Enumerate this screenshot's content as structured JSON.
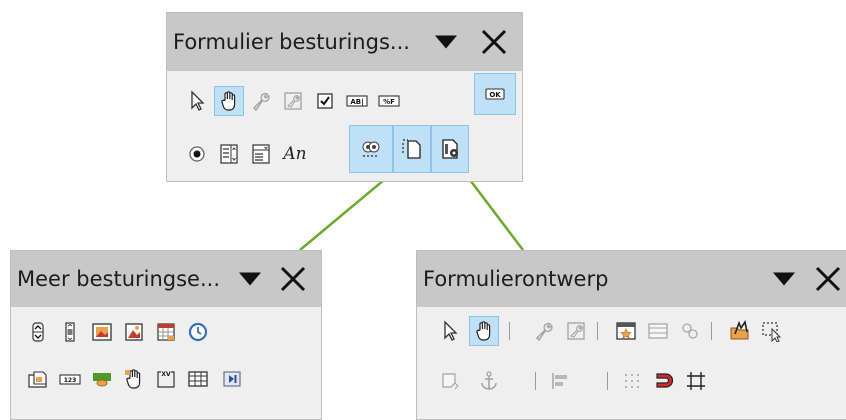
{
  "toolbars": {
    "form_controls": {
      "title": "Formulier besturings...",
      "icons": {
        "row1": [
          "select-arrow-icon",
          "design-mode-hand-icon",
          "control-properties-wrench-icon",
          "form-properties-icon",
          "checkbox-icon",
          "text-box-icon",
          "formatted-field-icon",
          "push-button-icon"
        ],
        "row2": [
          "option-button-icon",
          "list-box-icon",
          "combo-box-icon",
          "label-field-icon",
          "more-controls-icon",
          "form-design-icon",
          "wizards-icon"
        ]
      },
      "label_field_text": "An",
      "push_button_text": "OK",
      "text_box_text": "AB|",
      "formatted_field_text": "%F"
    },
    "more_controls": {
      "title": "Meer besturingse...",
      "icons": {
        "row1": [
          "spin-button-icon",
          "scrollbar-icon",
          "image-button-icon",
          "image-control-icon",
          "date-field-icon",
          "time-field-icon"
        ],
        "row2": [
          "file-selection-icon",
          "numerical-field-icon",
          "currency-field-icon",
          "pattern-field-icon",
          "group-box-icon",
          "table-control-icon",
          "navigation-bar-icon"
        ]
      },
      "numerical_field_text": "123",
      "pattern_field_text": "XV"
    },
    "form_design": {
      "title": "Formulierontwerp",
      "icons": {
        "row1": [
          "select-arrow-icon",
          "design-mode-hand-icon",
          "control-properties-icon",
          "form-properties-icon",
          "form-navigator-icon",
          "add-field-icon",
          "activation-order-icon",
          "open-design-mode-icon",
          "automatic-control-focus-icon"
        ],
        "row2": [
          "display-grid-icon",
          "anchor-icon",
          "align-icon",
          "snap-to-grid-icon",
          "magnet-icon",
          "guides-icon"
        ]
      }
    }
  },
  "colors": {
    "toolbar_bg": "#efefef",
    "titlebar_bg": "#c8c8c8",
    "active_bg": "#bfe0f6",
    "connector": "#6aaa2c"
  }
}
